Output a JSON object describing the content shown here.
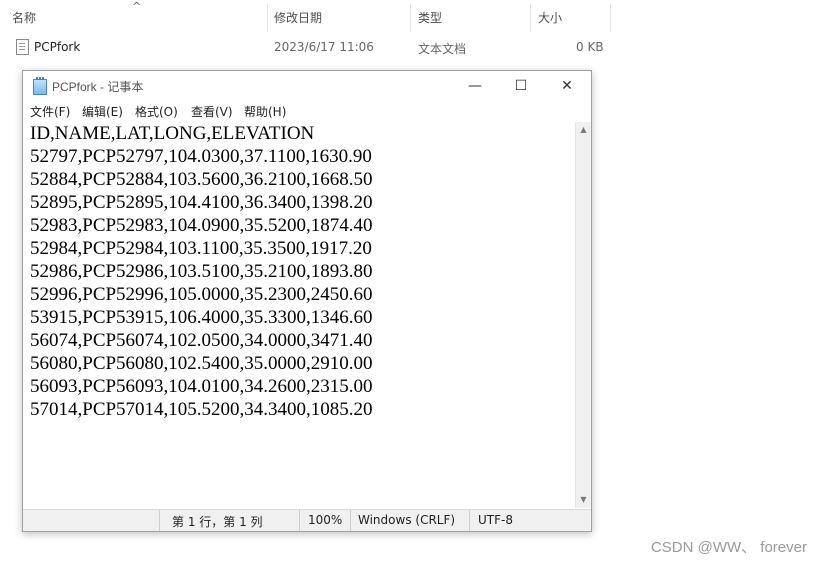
{
  "explorer": {
    "columns": [
      "名称",
      "修改日期",
      "类型",
      "大小"
    ],
    "sort_indicator": "^",
    "file": {
      "name": "PCPfork",
      "modified": "2023/6/17 11:06",
      "type": "文本文档",
      "size": "0 KB"
    }
  },
  "notepad": {
    "title": "PCPfork - 记事本",
    "window_controls": {
      "minimize": "—",
      "maximize": "☐",
      "close": "✕"
    },
    "menu": [
      "文件(F)",
      "编辑(E)",
      "格式(O)",
      "查看(V)",
      "帮助(H)"
    ],
    "content_lines": [
      "ID,NAME,LAT,LONG,ELEVATION",
      "52797,PCP52797,104.0300,37.1100,1630.90",
      "52884,PCP52884,103.5600,36.2100,1668.50",
      "52895,PCP52895,104.4100,36.3400,1398.20",
      "52983,PCP52983,104.0900,35.5200,1874.40",
      "52984,PCP52984,103.1100,35.3500,1917.20",
      "52986,PCP52986,103.5100,35.2100,1893.80",
      "52996,PCP52996,105.0000,35.2300,2450.60",
      "53915,PCP53915,106.4000,35.3300,1346.60",
      "56074,PCP56074,102.0500,34.0000,3471.40",
      "56080,PCP56080,102.5400,35.0000,2910.00",
      "56093,PCP56093,104.0100,34.2600,2315.00",
      "57014,PCP57014,105.5200,34.3400,1085.20"
    ],
    "status": {
      "position": "第 1 行，第 1 列",
      "zoom": "100%",
      "line_ending": "Windows (CRLF)",
      "encoding": "UTF-8"
    }
  },
  "watermark": "CSDN @WW、 forever"
}
